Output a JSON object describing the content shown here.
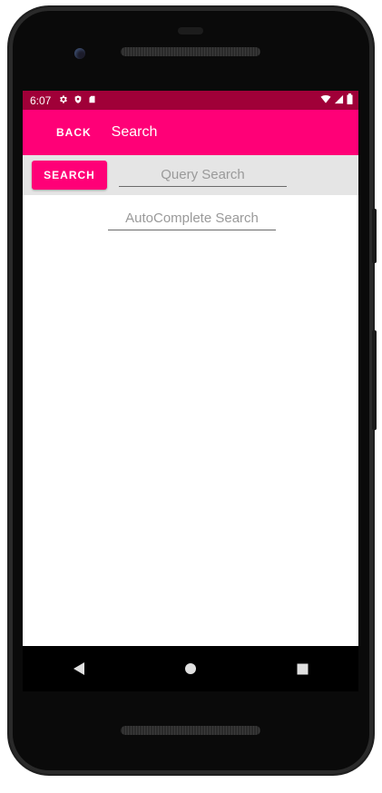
{
  "status_bar": {
    "time": "6:07",
    "left_icons": [
      "gear-icon",
      "shield-icon",
      "sd-card-icon"
    ],
    "right_icons": [
      "wifi-icon",
      "signal-icon",
      "battery-icon"
    ],
    "color": "#a00038"
  },
  "app_bar": {
    "back_label": "BACK",
    "title": "Search",
    "color": "#ff0077"
  },
  "search_row": {
    "button_label": "SEARCH",
    "query_placeholder": "Query Search",
    "query_value": ""
  },
  "main": {
    "autocomplete_placeholder": "AutoComplete Search",
    "autocomplete_value": ""
  },
  "nav_bar": {
    "buttons": [
      "back-triangle-icon",
      "home-circle-icon",
      "recents-square-icon"
    ]
  }
}
